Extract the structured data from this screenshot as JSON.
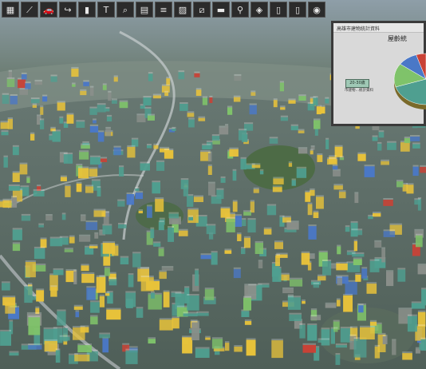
{
  "toolbar": {
    "icons": [
      {
        "name": "grid-icon",
        "glyph": "▦"
      },
      {
        "name": "measure-icon",
        "glyph": "⟋"
      },
      {
        "name": "car-icon",
        "glyph": "🚗"
      },
      {
        "name": "hook-icon",
        "glyph": "↪"
      },
      {
        "name": "bar-chart-icon",
        "glyph": "▮"
      },
      {
        "name": "t-square-icon",
        "glyph": "T"
      },
      {
        "name": "search-icon",
        "glyph": "⌕"
      },
      {
        "name": "building-icon",
        "glyph": "▤"
      },
      {
        "name": "layers-icon",
        "glyph": "≡"
      },
      {
        "name": "image-icon",
        "glyph": "▨"
      },
      {
        "name": "ruler-icon",
        "glyph": "⧄"
      },
      {
        "name": "road-icon",
        "glyph": "▬"
      },
      {
        "name": "location-pin-icon",
        "glyph": "⚲"
      },
      {
        "name": "cube-icon",
        "glyph": "◈"
      },
      {
        "name": "bookmark-icon",
        "glyph": "▯"
      },
      {
        "name": "phone-icon",
        "glyph": "▯"
      },
      {
        "name": "user-icon",
        "glyph": "◉"
      }
    ]
  },
  "popup": {
    "header": "高雄市建物統計資料",
    "title": "屋齡統",
    "legend_label": "20-30歲",
    "note": "市建物…統計資料",
    "colors": {
      "yellow": "#e9c33a",
      "teal": "#4f9f90",
      "green": "#7fc36a",
      "blue": "#4a78c7",
      "red": "#c94236",
      "gray": "#8a8f8a"
    }
  },
  "chart_data": {
    "type": "pie",
    "categories": [
      "",
      "",
      "",
      "",
      ""
    ],
    "values": [
      45,
      25,
      15,
      10,
      5
    ],
    "title": "屋齡統"
  }
}
